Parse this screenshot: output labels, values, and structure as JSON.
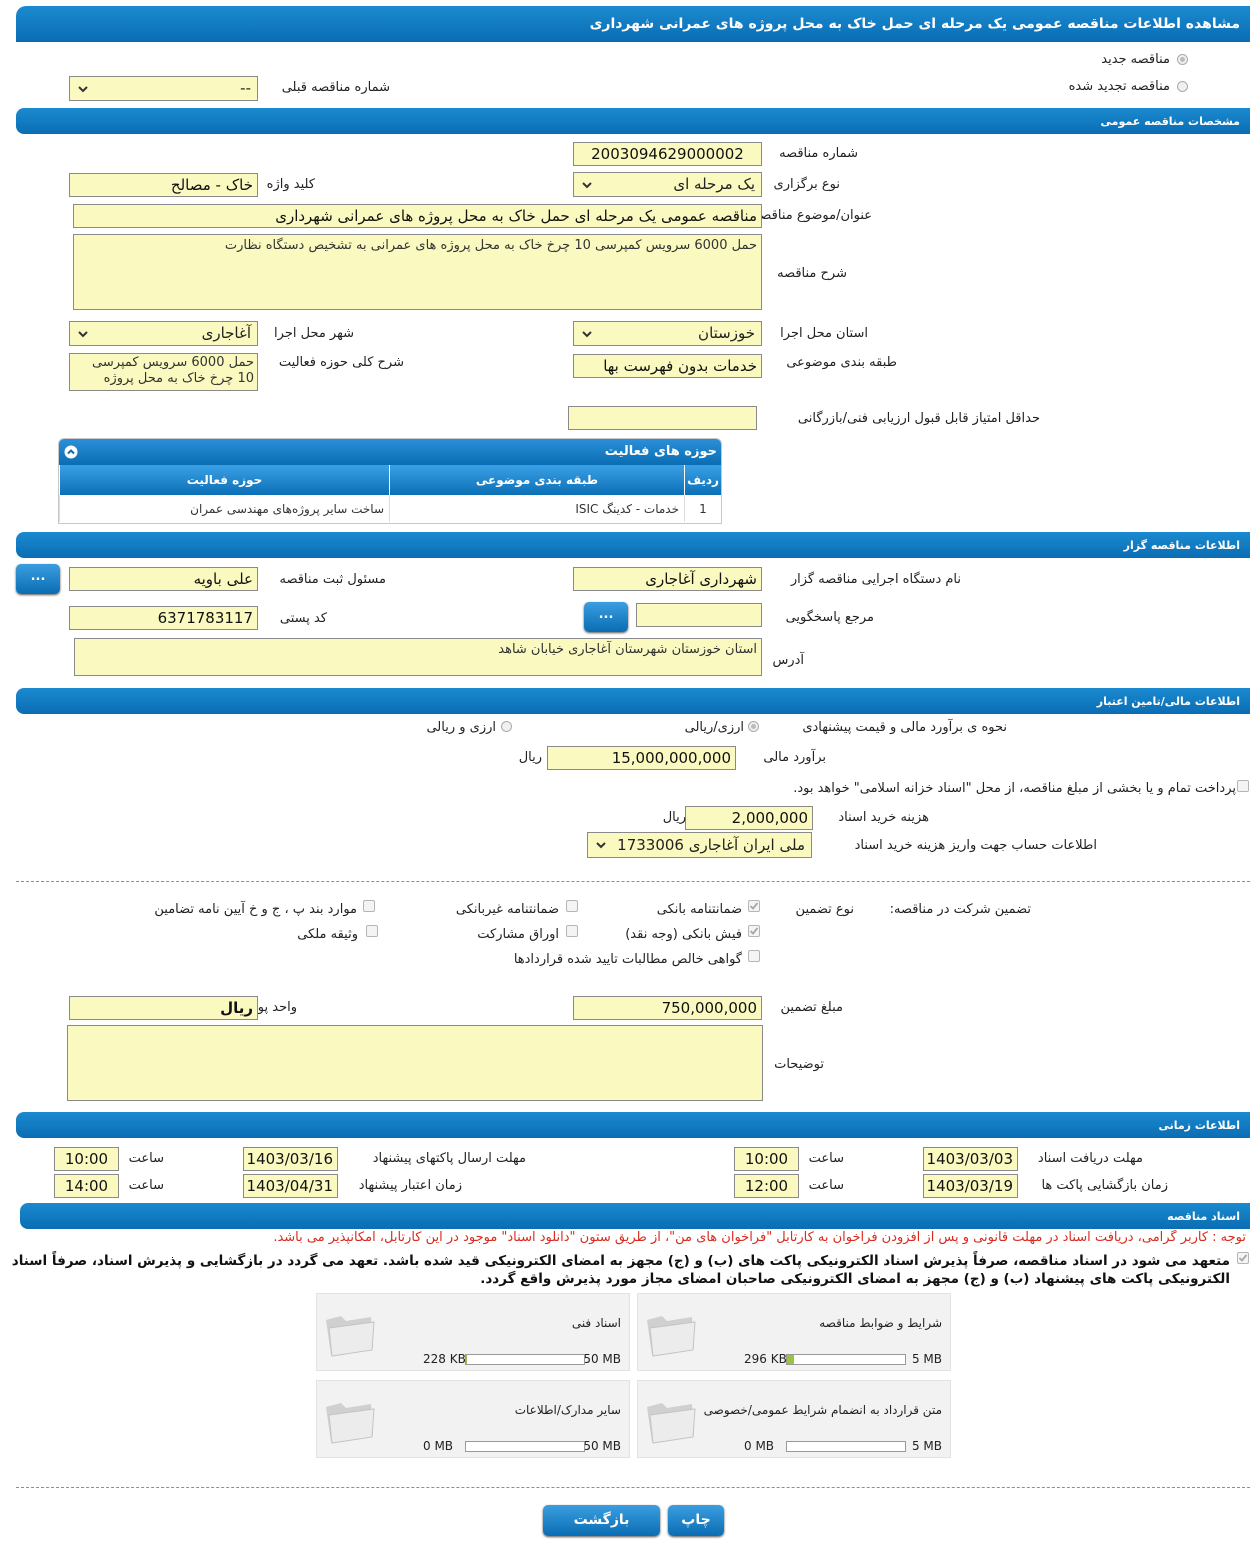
{
  "header": {
    "title": "مشاهده اطلاعات مناقصه عمومی یک مرحله ای حمل خاک به محل پروژه های عمرانی شهرداری"
  },
  "type_select": {
    "new": "مناقصه جدید",
    "renewed": "مناقصه تجدید شده",
    "prev_label": "شماره مناقصه قبلی",
    "prev_value": "--"
  },
  "general": {
    "section_title": "مشخصات مناقصه عمومی",
    "number_label": "شماره مناقصه",
    "number": "2003094629000002",
    "type_label": "نوع برگزاری",
    "type": "یک مرحله ای",
    "keyword_label": "کلید واژه",
    "keyword": "خاک - مصالح",
    "subject_label": "عنوان/موضوع مناقصه",
    "subject": "مناقصه عمومی یک مرحله ای حمل خاک به محل پروژه های عمرانی شهرداری",
    "desc_label": "شرح مناقصه",
    "desc": "حمل 6000 سرویس کمپرسی 10 چرخ خاک به محل پروژه های عمرانی به تشخیص دستگاه نظارت",
    "province_label": "استان محل اجرا",
    "province": "خوزستان",
    "city_label": "شهر محل اجرا",
    "city": "آغاجاری",
    "category_label": "طبقه بندی موضوعی",
    "category": "خدمات بدون فهرست بها",
    "scope_label": "شرح کلی حوزه فعالیت",
    "scope": "حمل 6000 سرویس کمپرسی 10 چرخ خاک به محل پروژه",
    "minscore_label": "حداقل امتیاز قابل قبول ارزیابی فنی/بازرگانی",
    "minscore": ""
  },
  "activity": {
    "title": "حوزه های فعالیت",
    "columns": [
      "ردیف",
      "طبقه بندی موضوعی",
      "حوزه فعالیت"
    ],
    "rows": [
      [
        "1",
        "خدمات - کدینگ ISIC",
        "ساخت سایر پروژه‌های مهندسی عمران"
      ]
    ]
  },
  "organizer": {
    "section_title": "اطلاعات مناقصه گزار",
    "org_label": "نام دستگاه اجرایی مناقصه گزار",
    "org": "شهرداری آغاجاری",
    "resp_label": "مسئول ثبت مناقصه",
    "resp": "علی باویه",
    "ref_label": "مرجع پاسخگویی",
    "ref": "",
    "postal_label": "کد پستی",
    "postal": "6371783117",
    "address_label": "آدرس",
    "address": "استان خوزستان شهرستان آغاجاری خیابان شاهد",
    "more_button": "..."
  },
  "finance": {
    "section_title": "اطلاعات مالی/تامین اعتبار",
    "method_label": "نحوه ی برآورد مالی و قیمت پیشنهادی",
    "opt1": "ارزی/ریالی",
    "opt2": "ارزی و ریالی",
    "estimate_label": "برآورد مالی",
    "estimate": "15,000,000,000",
    "currency": "ریال",
    "treasury_text": "پرداخت تمام و یا بخشی از مبلغ مناقصه، از محل \"اسناد خزانه اسلامی\" خواهد بود.",
    "docfee_label": "هزینه خرید اسناد",
    "docfee": "2,000,000",
    "docfee_currency": "ریال",
    "account_label": "اطلاعات حساب جهت واریز هزینه خرید اسناد",
    "account": "ملی ایران آغاجاری 1733006"
  },
  "guarantee": {
    "title_label": "تضمین شرکت در مناقصه:",
    "type_label": "نوع تضمین",
    "items": [
      "ضمانتنامه بانکی",
      "ضمانتنامه غیربانکی",
      "موارد بند پ ، ج و خ آیین نامه تضامین",
      "فیش بانکی (وجه نقد)",
      "اوراق مشارکت",
      "وثیقه ملکی",
      "گواهی خالص مطالبات تایید شده قراردادها"
    ],
    "amount_label": "مبلغ تضمین",
    "amount": "750,000,000",
    "unit_label": "واحد پول",
    "unit": "ریال",
    "notes_label": "توضیحات",
    "notes": ""
  },
  "timing": {
    "section_title": "اطلاعات زمانی",
    "time_label": "ساعت",
    "recv_label": "مهلت دریافت اسناد",
    "recv_date": "1403/03/03",
    "recv_time": "10:00",
    "send_label": "مهلت ارسال پاکتهای پیشنهاد",
    "send_date": "1403/03/16",
    "send_time": "10:00",
    "open_label": "زمان بازگشایی پاکت ها",
    "open_date": "1403/03/19",
    "open_time": "12:00",
    "valid_label": "زمان اعتبار پیشنهاد",
    "valid_date": "1403/04/31",
    "valid_time": "14:00"
  },
  "documents": {
    "section_title": "اسناد مناقصه",
    "notice": "توجه : کاربر گرامی، دریافت اسناد در مهلت قانونی و پس از افزودن فراخوان به کارتابل \"فراخوان های من\"، از طریق ستون \"دانلود اسناد\" موجود در این کارتابل، امکانپذیر می باشد.",
    "commit": "متعهد می شود در اسناد مناقصه، صرفاً پذیرش اسناد الکترونیکی پاکت های (ب) و (ج) مجهز به امضای الکترونیکی قید شده باشد. تعهد می گردد در بازگشایی و پذیرش اسناد، صرفاً اسناد الکترونیکی پاکت های پیشنهاد (ب) و (ج) مجهز به امضای الکترونیکی صاحبان امضای مجاز مورد پذیرش واقع گردد.",
    "cards": [
      {
        "title": "شرایط و ضوابط مناقصه",
        "size": "296 KB",
        "max": "5 MB",
        "fill": 0.06
      },
      {
        "title": "اسناد فنی",
        "size": "228 KB",
        "max": "50 MB",
        "fill": 0.005
      },
      {
        "title": "متن قرارداد به انضمام شرایط عمومی/خصوصی",
        "size": "0 MB",
        "max": "5 MB",
        "fill": 0
      },
      {
        "title": "سایر مدارک/اطلاعات",
        "size": "0 MB",
        "max": "50 MB",
        "fill": 0
      }
    ]
  },
  "footer": {
    "print": "چاپ",
    "back": "بازگشت"
  },
  "colors": {
    "bar": "#0a6db3",
    "field": "#fafac0",
    "notice": "#d92b20"
  }
}
